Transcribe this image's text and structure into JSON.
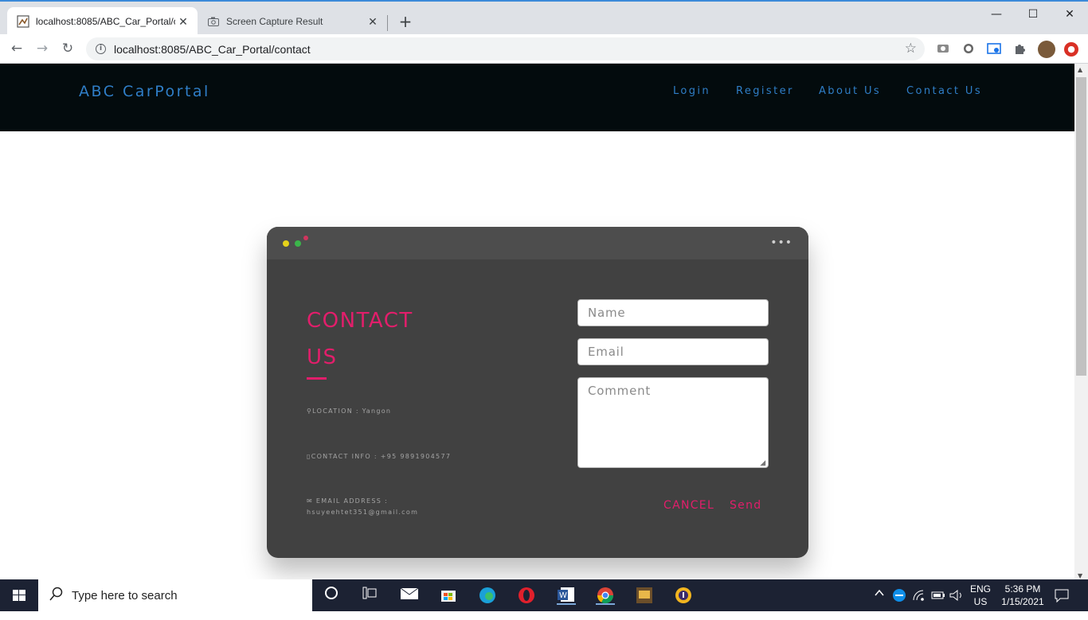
{
  "browser": {
    "tabs": [
      {
        "title": "localhost:8085/ABC_Car_Portal/contact",
        "display": "localhost:8085/ABC_Car_Portal/cc",
        "close": "✕"
      },
      {
        "title": "Screen Capture Result",
        "close": "✕"
      }
    ],
    "new_tab": "+",
    "url": "localhost:8085/ABC_Car_Portal/contact",
    "window_controls": {
      "minimize": "—",
      "maximize": "☐",
      "close": "✕"
    }
  },
  "site": {
    "brand": "ABC CarPortal",
    "nav": [
      "Login",
      "Register",
      "About Us",
      "Contact Us"
    ]
  },
  "contact": {
    "title": "CONTACT US",
    "location": "LOCATION : Yangon",
    "contact_info": "CONTACT INFO : +95 9891904577",
    "email_label": "EMAIL ADDRESS :",
    "email_value": "hsuyeehtet351@gmail.com",
    "name_placeholder": "Name",
    "email_placeholder": "Email",
    "comment_placeholder": "Comment",
    "cancel": "CANCEL",
    "send": "Send",
    "window_dots_colors": [
      "#e6d21a",
      "#3bb54a",
      "#d0355e"
    ],
    "accent": "#e21e6b"
  },
  "taskbar": {
    "search_placeholder": "Type here to search",
    "lang_top": "ENG",
    "lang_bottom": "US",
    "time": "5:36 PM",
    "date": "1/15/2021"
  },
  "colors": {
    "navbar_bg": "#030b0d",
    "link": "#2f7ec7",
    "card_bg": "#414141"
  }
}
